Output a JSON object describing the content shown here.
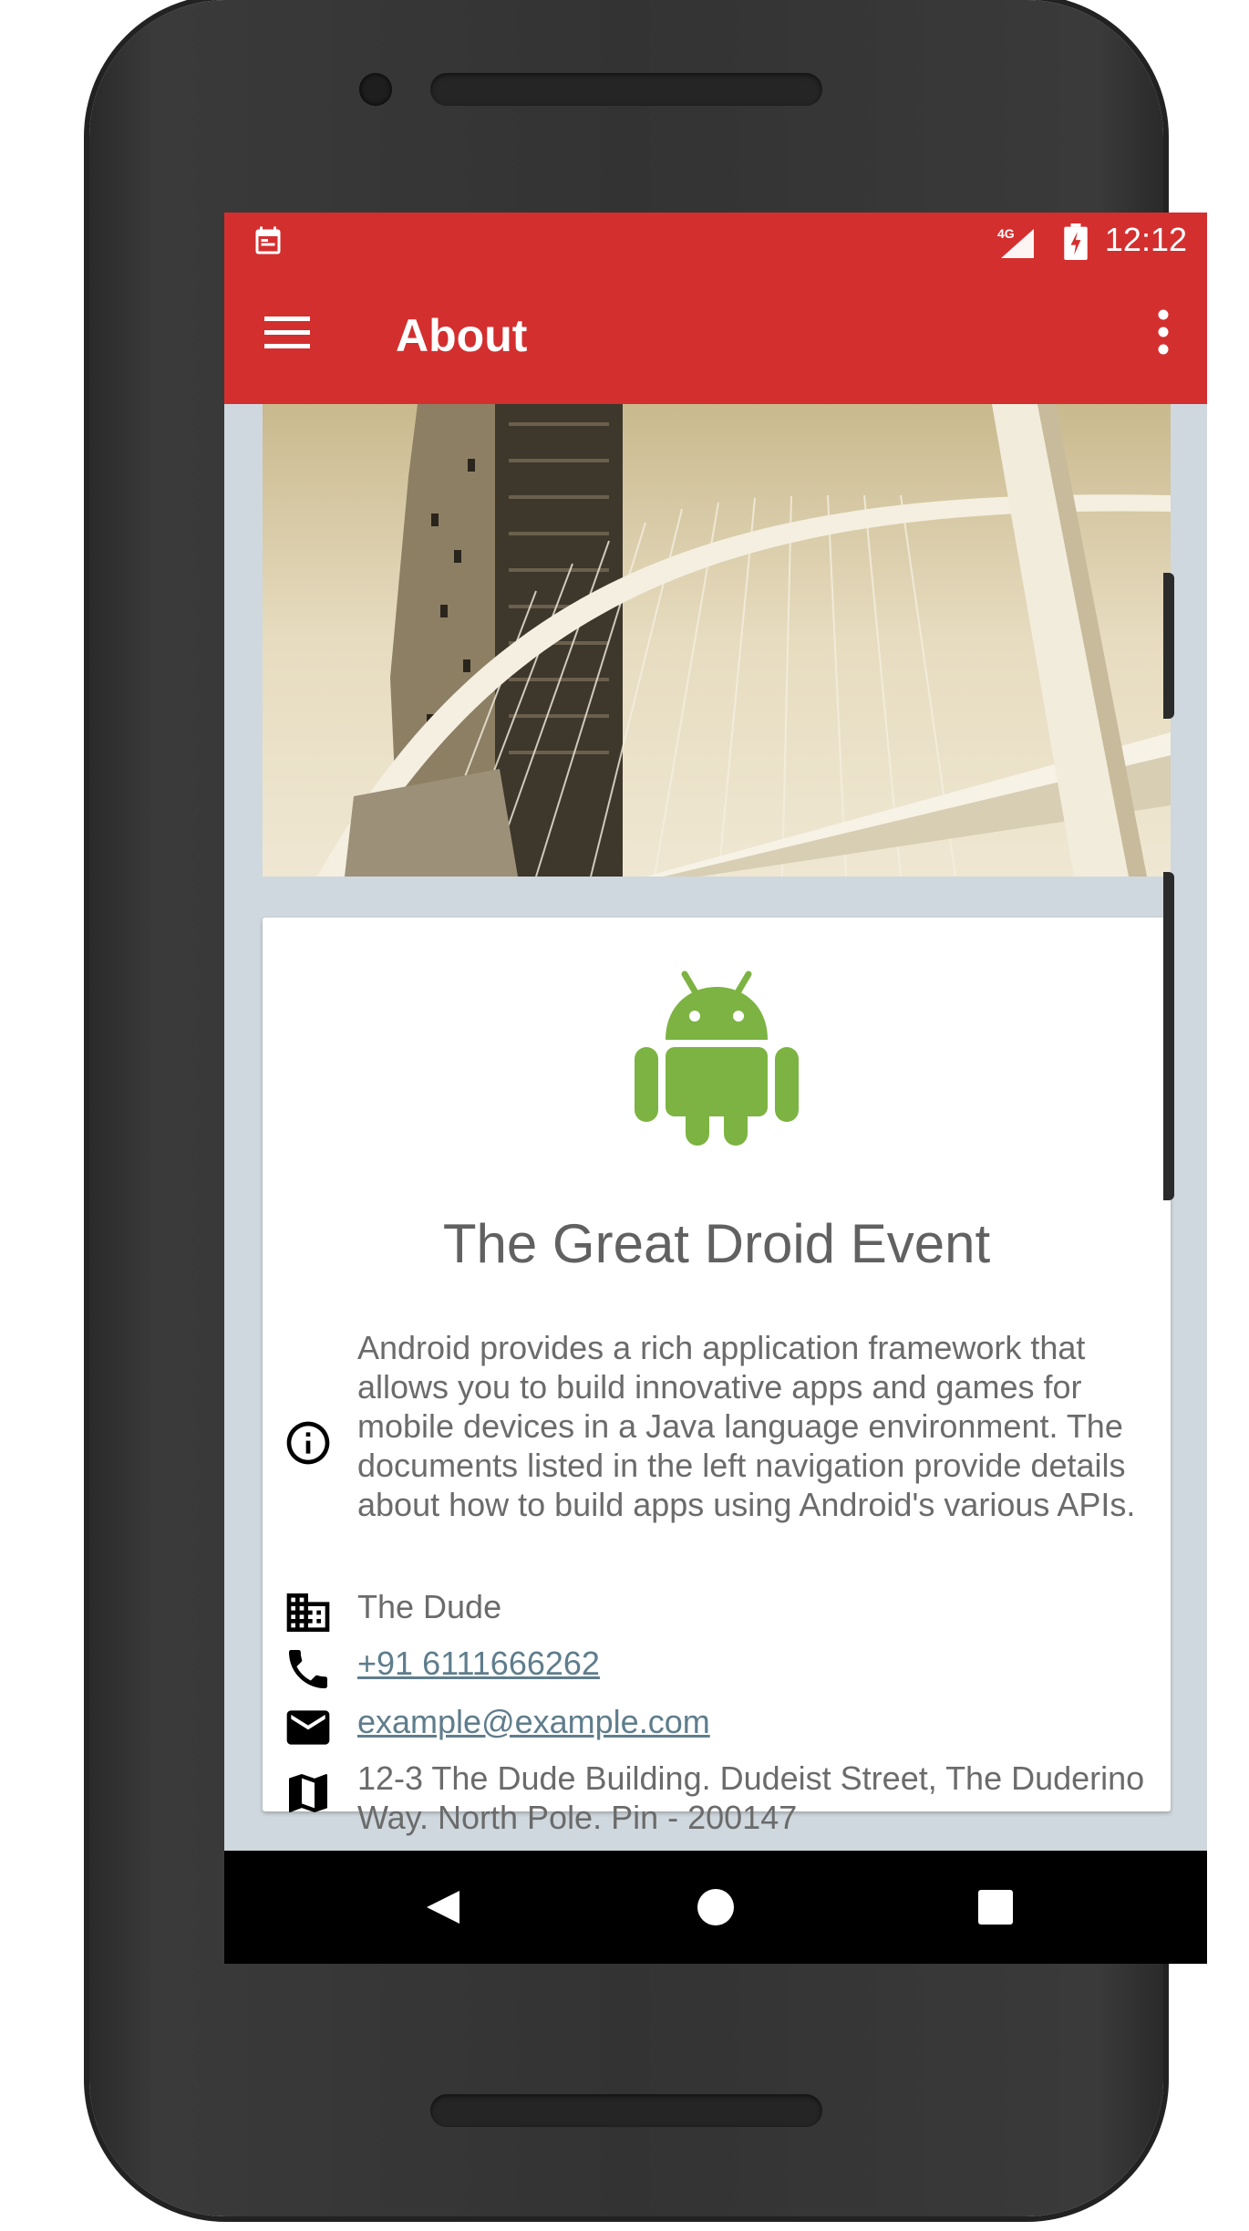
{
  "statusbar": {
    "time": "12:12",
    "network": "4G",
    "icons": [
      "calendar-icon",
      "signal-icon",
      "battery-icon"
    ]
  },
  "appbar": {
    "title": "About",
    "icons": [
      "menu-icon",
      "more-vert-icon"
    ]
  },
  "card": {
    "title": "The Great Droid Event",
    "description": "Android provides a rich application framework that allows you to build innovative apps and games for mobile devices in a Java language environment. The documents listed in the left navigation provide details about how to build apps using Android's various APIs.",
    "organizer": "The Dude",
    "phone": "+91 6111666262",
    "email": "example@example.com",
    "address": "12-3 The Dude Building. Dudeist Street, The Duderino Way. North Pole. Pin - 200147"
  },
  "colors": {
    "primary": "#d32f2f",
    "background": "#cfd8de",
    "android_green": "#7cb342",
    "link": "#5f7d8c"
  },
  "navbar": {
    "icons": [
      "back-icon",
      "home-icon",
      "recents-icon"
    ]
  }
}
